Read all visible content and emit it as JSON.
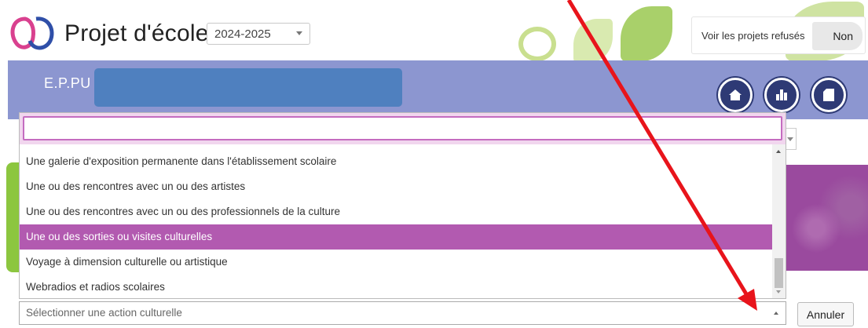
{
  "header": {
    "title": "Projet d'école",
    "year_select_value": "2024-2025",
    "refused_label": "Voir les projets refusés",
    "refused_toggle_value": "Non"
  },
  "banner": {
    "school_prefix": "E.P.PU"
  },
  "dropdown": {
    "search_value": "",
    "options": [
      "Une galerie d'exposition permanente dans l'établissement scolaire",
      "Une ou des rencontres avec un ou des artistes",
      "Une ou des rencontres avec un ou des professionnels de la culture",
      "Une ou des sorties ou visites culturelles",
      "Voyage à dimension culturelle ou artistique",
      "Webradios et radios scolaires"
    ],
    "active_option": "Une ou des sorties ou visites culturelles"
  },
  "select": {
    "placeholder": "Sélectionner une action culturelle"
  },
  "buttons": {
    "cancel": "Annuler"
  },
  "icons": [
    "logo-icon",
    "home-icon",
    "chart-icon",
    "document-icon"
  ],
  "colors": {
    "banner": "#8c96d0",
    "active_option": "#b25ab0",
    "round_buttons": "#2e3a75",
    "annotation_arrow": "#e8141b"
  }
}
